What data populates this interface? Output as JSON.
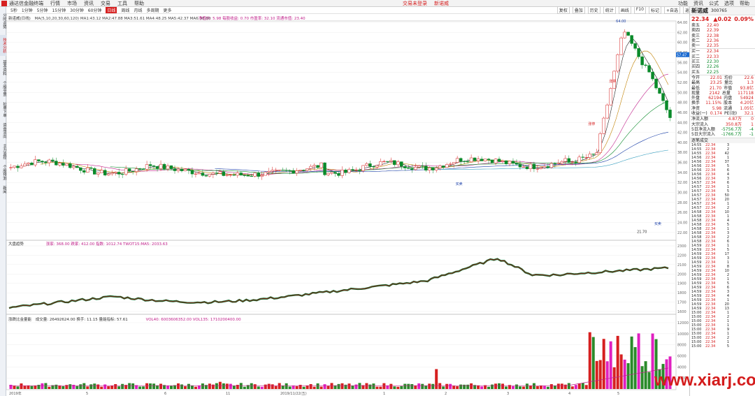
{
  "menubar": {
    "app_title": "通达信金融终端",
    "items": [
      "行情",
      "市场",
      "资讯",
      "交易",
      "工具",
      "帮助"
    ],
    "center_links": [
      "交易未登录",
      "新诺威"
    ],
    "right_items": [
      "功能",
      "资讯",
      "公式",
      "选项",
      "帮助"
    ]
  },
  "toolbar": {
    "periods": [
      "5秒",
      "1分钟",
      "5分钟",
      "15分钟",
      "30分钟",
      "60分钟",
      "日线",
      "周线",
      "月线",
      "多周期",
      "更多"
    ],
    "selected": "日线",
    "right_tabs": [
      "复权",
      "叠加",
      "历史",
      "统计",
      "画线",
      "F10",
      "标记",
      "+自选",
      "返回"
    ]
  },
  "leftnav": [
    "分时走势",
    "技术分析",
    "基本资料",
    "个股全景",
    "扯单下单",
    "资金流向",
    "主力监控",
    "个股预测",
    "新闻"
  ],
  "chart1": {
    "stock_name": "新诺威(日线)",
    "ma_line": "MA(5,10,20,30,60,120)  MA1:43.12  MA2:47.88  MA3:51.61  MA4:48.25  MA5:42.37  MA6:38.00",
    "extra_line": "净值价: 5.98  每股收益: 0.70  市盈率: 32.10  流通市值: 23.40",
    "price_axis": [
      "64.00",
      "62.00",
      "60.00",
      "58.00",
      "56.00",
      "54.00",
      "52.00",
      "50.00",
      "48.00",
      "46.00",
      "44.00",
      "42.00",
      "40.00",
      "38.00",
      "36.00",
      "34.00",
      "32.00",
      "30.00",
      "28.00",
      "26.00",
      "24.00",
      "22.00"
    ],
    "last_price_tag": "57.47",
    "annotations": {
      "high": "64.00",
      "low": "21.70",
      "b1": "买卖",
      "b2": "买卖",
      "b3": "涨停",
      "b4": "涨停"
    }
  },
  "chart2": {
    "name": "大盘趋势",
    "vals": "涨家: 368.00  跌家: 412.00  指数: 1012.74  TWOT15:MA5: 2033.63",
    "axis": [
      "2300",
      "2200",
      "2100",
      "2000",
      "1900",
      "1800",
      "1700",
      "1600"
    ]
  },
  "chart3": {
    "name": "涨跌比金量能",
    "vals": "成交量: 26492624.00  换手: 11.15  量能指标: 57.61",
    "vol": "VOL40: 6003606352.00  VOL135: 1710200400.00",
    "axis": [
      "12000",
      "10000",
      "8000",
      "6000",
      "4000",
      "2000"
    ]
  },
  "date_axis": [
    "2019年",
    "5",
    "6",
    "11",
    "2019/11/22(五)",
    "1",
    "2",
    "3",
    "4",
    "5"
  ],
  "quote": {
    "name": "新诺威",
    "code": "300765",
    "price": "22.34",
    "change": "▲0.02",
    "pct": "0.09%",
    "asks": [
      [
        "卖五",
        "22.40",
        ""
      ],
      [
        "卖四",
        "22.39",
        ""
      ],
      [
        "卖三",
        "22.38",
        ""
      ],
      [
        "卖二",
        "22.36",
        ""
      ],
      [
        "卖一",
        "22.35",
        ""
      ]
    ],
    "bids": [
      [
        "买一",
        "22.34",
        ""
      ],
      [
        "买二",
        "22.33",
        ""
      ],
      [
        "买三",
        "22.30",
        ""
      ],
      [
        "买四",
        "22.26",
        ""
      ],
      [
        "买五",
        "22.25",
        ""
      ]
    ],
    "stats": [
      [
        "今开",
        "22.01",
        "均价",
        "22.6"
      ],
      [
        "最高",
        "23.25",
        "量比",
        "1.3"
      ],
      [
        "最低",
        "21.70",
        "市值",
        "93.8亿"
      ],
      [
        "现量",
        "2142",
        "总量",
        "117118"
      ],
      [
        "外盘",
        "62194",
        "内盘",
        "54924"
      ],
      [
        "换手",
        "11.15%",
        "股本",
        "4.20亿"
      ],
      [
        "净资",
        "5.98",
        "流通",
        "1.05亿"
      ],
      [
        "收益(一)",
        "0.174",
        "PE(动)",
        "32.1"
      ]
    ],
    "flows": [
      [
        "净流入额",
        "4.87万",
        "0"
      ],
      [
        "大宗流入",
        "350.8万",
        "1"
      ],
      [
        "5日净流入额",
        "-5756.7万",
        "-4"
      ],
      [
        "5日大宗流入",
        "-1766.7万",
        "-1"
      ]
    ],
    "ticks_header": "逐笔成交",
    "ticks": [
      [
        "14:55",
        "22.34",
        "3"
      ],
      [
        "14:55",
        "22.34",
        "2"
      ],
      [
        "14:55",
        "22.34",
        "42"
      ],
      [
        "14:56",
        "22.34",
        "1"
      ],
      [
        "14:56",
        "22.34",
        "37"
      ],
      [
        "14:56",
        "22.34",
        "5"
      ],
      [
        "14:56",
        "22.34",
        "6"
      ],
      [
        "14:56",
        "22.34",
        "4"
      ],
      [
        "14:56",
        "22.34",
        "3"
      ],
      [
        "14:57",
        "22.34",
        "6"
      ],
      [
        "14:57",
        "22.34",
        "1"
      ],
      [
        "14:57",
        "22.34",
        "5"
      ],
      [
        "14:57",
        "22.34",
        "50"
      ],
      [
        "14:57",
        "22.34",
        "20"
      ],
      [
        "14:57",
        "22.34",
        "1"
      ],
      [
        "14:57",
        "22.34",
        "2"
      ],
      [
        "14:58",
        "22.34",
        "10"
      ],
      [
        "14:58",
        "22.34",
        "1"
      ],
      [
        "14:58",
        "22.34",
        "4"
      ],
      [
        "14:58",
        "22.34",
        "5"
      ],
      [
        "14:58",
        "22.34",
        "1"
      ],
      [
        "14:58",
        "22.34",
        "3"
      ],
      [
        "14:58",
        "22.34",
        "2"
      ],
      [
        "14:58",
        "22.34",
        "6"
      ],
      [
        "14:59",
        "22.34",
        "1"
      ],
      [
        "14:59",
        "22.34",
        "5"
      ],
      [
        "14:59",
        "22.34",
        "17"
      ],
      [
        "14:59",
        "22.34",
        "3"
      ],
      [
        "14:59",
        "22.34",
        "1"
      ],
      [
        "14:59",
        "22.34",
        "8"
      ],
      [
        "14:59",
        "22.34",
        "10"
      ],
      [
        "14:59",
        "22.34",
        "2"
      ],
      [
        "14:59",
        "22.34",
        "1"
      ],
      [
        "14:59",
        "22.34",
        "5"
      ],
      [
        "14:59",
        "22.34",
        "6"
      ],
      [
        "14:59",
        "22.34",
        "3"
      ],
      [
        "14:59",
        "22.34",
        "4"
      ],
      [
        "14:59",
        "22.34",
        "1"
      ],
      [
        "14:59",
        "22.34",
        "20"
      ],
      [
        "14:59",
        "22.34",
        "13"
      ],
      [
        "15:00",
        "22.34",
        "1"
      ],
      [
        "15:00",
        "22.34",
        "2"
      ],
      [
        "15:00",
        "22.34",
        "1"
      ],
      [
        "15:00",
        "22.34",
        "1"
      ],
      [
        "15:00",
        "22.34",
        "9"
      ],
      [
        "15:00",
        "22.34",
        "1"
      ],
      [
        "15:00",
        "22.34",
        "2"
      ],
      [
        "15:00",
        "22.34",
        "1"
      ],
      [
        "15:00",
        "22.34",
        "5"
      ]
    ]
  },
  "watermark": "www.xiarj.com"
}
